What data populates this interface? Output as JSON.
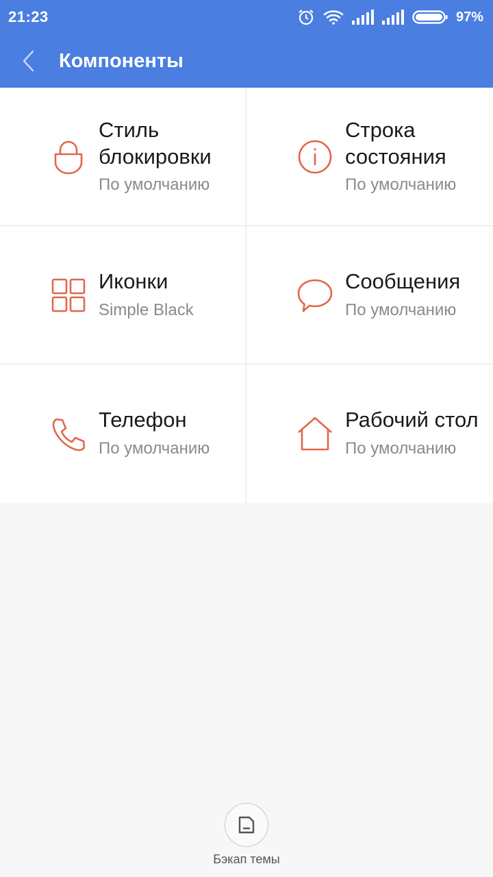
{
  "status_bar": {
    "time": "21:23",
    "battery_percent": "97%",
    "icons": [
      "alarm-icon",
      "wifi-icon",
      "signal-icon",
      "signal-icon",
      "battery-icon"
    ]
  },
  "app_bar": {
    "title": "Компоненты",
    "back_icon": "chevron-left-icon",
    "color": "#4a7ee0"
  },
  "components": [
    {
      "title": "Стиль\nблокировки",
      "subtitle": "По умолчанию",
      "icon": "lock-icon"
    },
    {
      "title": "Строка\nсостояния",
      "subtitle": "По умолчанию",
      "icon": "info-icon"
    },
    {
      "title": "Иконки",
      "subtitle": "Simple Black",
      "icon": "grid-icon"
    },
    {
      "title": "Сообщения",
      "subtitle": "По умолчанию",
      "icon": "message-icon"
    },
    {
      "title": "Телефон",
      "subtitle": "По умолчанию",
      "icon": "phone-icon"
    },
    {
      "title": "Рабочий стол",
      "subtitle": "По умолчанию",
      "icon": "home-icon"
    }
  ],
  "icon_color": "#e2664a",
  "footer": {
    "backup_label": "Бэкап темы",
    "icon": "backup-icon"
  }
}
